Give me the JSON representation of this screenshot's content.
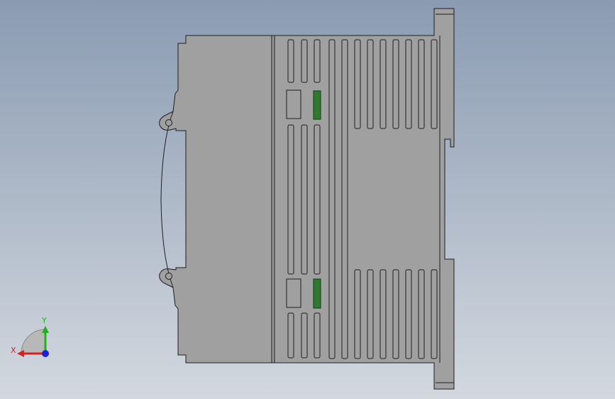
{
  "view": {
    "background_top": "#8a9bb2",
    "background_bottom": "#d3d8df"
  },
  "part": {
    "body_color": "#a0a0a0",
    "body_shade": "#989898",
    "edge_color": "#1e1e1e",
    "indicator_color": "#2f7a2f",
    "indicator_edge": "#0f3d0f"
  },
  "triad": {
    "x_label": "X",
    "y_label": "Y",
    "x_color": "#d62020",
    "y_color": "#20b020",
    "z_color": "#2020d8",
    "plane_color": "#b8b8b8"
  }
}
